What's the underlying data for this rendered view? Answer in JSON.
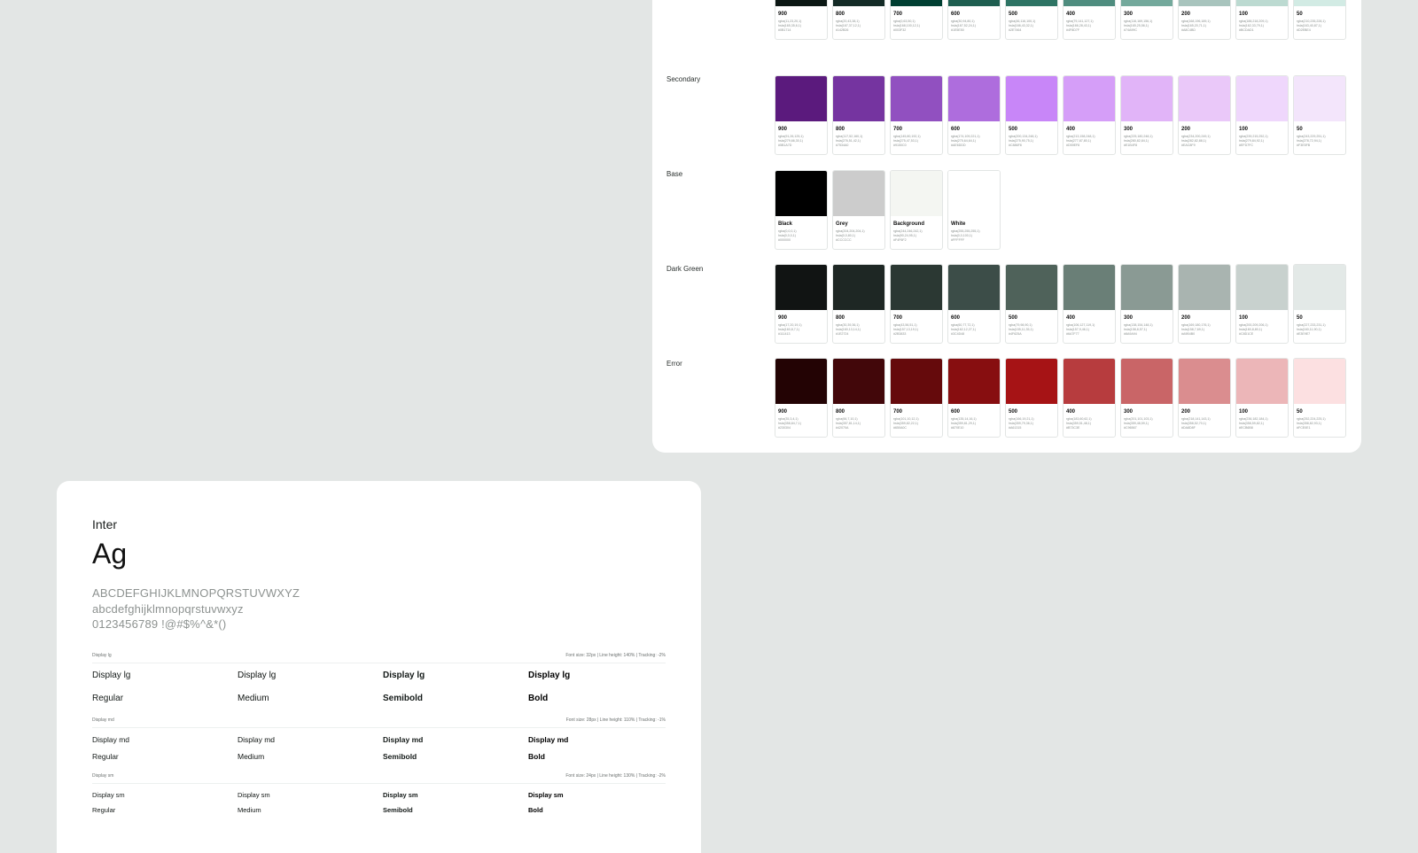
{
  "palette": {
    "rows": [
      {
        "label": "",
        "swatches": [
          {
            "name": "900",
            "color": "#0b1714",
            "detail": [
              "rgba(11,23,20,1)",
              "hsla(165,35,6,1)",
              "#0B1714"
            ]
          },
          {
            "name": "800",
            "color": "#142b26",
            "detail": [
              "rgba(20,43,38,1)",
              "hsla(167,37,12,1)",
              "#142B26"
            ]
          },
          {
            "name": "700",
            "color": "#003f32",
            "detail": [
              "rgba(0,63,50,1)",
              "hsla(168,100,12,1)",
              "#003F32"
            ]
          },
          {
            "name": "600",
            "color": "#1e5e50",
            "detail": [
              "rgba(30,94,80,1)",
              "hsla(167,52,24,1)",
              "#1E5E50"
            ]
          },
          {
            "name": "500",
            "color": "#2e7464",
            "detail": [
              "rgba(46,116,100,1)",
              "hsla(166,43,32,1)",
              "#2E7464"
            ]
          },
          {
            "name": "400",
            "color": "#4f8d7f",
            "detail": [
              "rgba(79,141,127,1)",
              "hsla(166,28,43,1)",
              "#4F8D7F"
            ]
          },
          {
            "name": "300",
            "color": "#74a99c",
            "detail": [
              "rgba(116,169,156,1)",
              "hsla(165,25,56,1)",
              "#74A99C"
            ]
          },
          {
            "name": "200",
            "color": "#a8c4bd",
            "detail": [
              "rgba(168,196,189,1)",
              "hsla(165,20,71,1)",
              "#A8C4BD"
            ]
          },
          {
            "name": "100",
            "color": "#bcdad1",
            "detail": [
              "rgba(188,218,209,1)",
              "hsla(162,33,79,1)",
              "#BCDAD1"
            ]
          },
          {
            "name": "50",
            "color": "#d2ebe4",
            "detail": [
              "rgba(210,235,228,1)",
              "hsla(163,40,87,1)",
              "#D2EBE4"
            ]
          }
        ]
      },
      {
        "label": "Secondary",
        "swatches": [
          {
            "name": "900",
            "color": "#5b1a7d",
            "detail": [
              "rgba(91,26,125,1)",
              "hsla(279,66,30,1)",
              "#5B1A7D"
            ]
          },
          {
            "name": "800",
            "color": "#7534a0",
            "detail": [
              "rgba(117,52,160,1)",
              "hsla(276,51,42,1)",
              "#7534A0"
            ]
          },
          {
            "name": "700",
            "color": "#9150c0",
            "detail": [
              "rgba(145,80,192,1)",
              "hsla(275,47,53,1)",
              "#9150C0"
            ]
          },
          {
            "name": "600",
            "color": "#ae6ddd",
            "detail": [
              "rgba(174,109,221,1)",
              "hsla(275,64,64,1)",
              "#AE6DDD"
            ]
          },
          {
            "name": "500",
            "color": "#c886f8",
            "detail": [
              "rgba(200,134,248,1)",
              "hsla(275,90,75,1)",
              "#C886F8"
            ]
          },
          {
            "name": "400",
            "color": "#d59ef8",
            "detail": [
              "rgba(213,158,248,1)",
              "hsla(277,87,80,1)",
              "#D59EF8"
            ]
          },
          {
            "name": "300",
            "color": "#e1b4f8",
            "detail": [
              "rgba(225,180,248,1)",
              "hsla(280,82,84,1)",
              "#E1B4F8"
            ]
          },
          {
            "name": "200",
            "color": "#eac8f9",
            "detail": [
              "rgba(234,200,249,1)",
              "hsla(282,82,88,1)",
              "#EAC8F9"
            ]
          },
          {
            "name": "100",
            "color": "#efd7fc",
            "detail": [
              "rgba(239,215,252,1)",
              "hsla(279,84,92,1)",
              "#EFD7FC"
            ]
          },
          {
            "name": "50",
            "color": "#f3e5fb",
            "detail": [
              "rgba(243,229,251,1)",
              "hsla(278,72,94,1)",
              "#F3E5FB"
            ]
          }
        ]
      },
      {
        "label": "Base",
        "swatches": [
          {
            "name": "Black",
            "color": "#000000",
            "detail": [
              "rgba(0,0,0,1)",
              "hsla(0,0,0,1)",
              "#000000"
            ]
          },
          {
            "name": "Grey",
            "color": "#cccccc",
            "detail": [
              "rgba(204,204,204,1)",
              "hsla(0,0,80,1)",
              "#CCCCCC"
            ]
          },
          {
            "name": "Background",
            "color": "#f4f6f2",
            "detail": [
              "rgba(244,246,242,1)",
              "hsla(90,24,95,1)",
              "#F4F6F2"
            ]
          },
          {
            "name": "White",
            "color": "#ffffff",
            "detail": [
              "rgba(255,255,255,1)",
              "hsla(0,0,100,1)",
              "#FFFFFF"
            ]
          }
        ]
      },
      {
        "label": "Dark Green",
        "swatches": [
          {
            "name": "900",
            "color": "#111413",
            "detail": [
              "rgba(17,20,19,1)",
              "hsla(160,8,7,1)",
              "#111413"
            ]
          },
          {
            "name": "800",
            "color": "#1e2724",
            "detail": [
              "rgba(30,39,36,1)",
              "hsla(160,13,14,1)",
              "#1E2724"
            ]
          },
          {
            "name": "700",
            "color": "#2b3833",
            "detail": [
              "rgba(43,56,51,1)",
              "hsla(157,13,19,1)",
              "#2B3833"
            ]
          },
          {
            "name": "600",
            "color": "#3c4d48",
            "detail": [
              "rgba(60,77,72,1)",
              "hsla(162,12,27,1)",
              "#3C4D48"
            ]
          },
          {
            "name": "500",
            "color": "#4f625a",
            "detail": [
              "rgba(79,98,90,1)",
              "hsla(155,11,35,1)",
              "#4F625A"
            ]
          },
          {
            "name": "400",
            "color": "#6a7f77",
            "detail": [
              "rgba(106,127,119,1)",
              "hsla(157,9,46,1)",
              "#6A7F77"
            ]
          },
          {
            "name": "300",
            "color": "#8a9a94",
            "detail": [
              "rgba(138,154,148,1)",
              "hsla(158,8,57,1)",
              "#8A9A94"
            ]
          },
          {
            "name": "200",
            "color": "#a9b4b0",
            "detail": [
              "rgba(169,180,176,1)",
              "hsla(158,7,69,1)",
              "#A9B4B0"
            ]
          },
          {
            "name": "100",
            "color": "#c8d1ce",
            "detail": [
              "rgba(200,209,206,1)",
              "hsla(160,8,80,1)",
              "#C8D1CE"
            ]
          },
          {
            "name": "50",
            "color": "#e3e9e7",
            "detail": [
              "rgba(227,233,231,1)",
              "hsla(160,11,90,1)",
              "#E3E9E7"
            ]
          }
        ]
      },
      {
        "label": "Error",
        "swatches": [
          {
            "name": "900",
            "color": "#230304",
            "detail": [
              "rgba(35,3,4,1)",
              "hsla(358,84,7,1)",
              "#230304"
            ]
          },
          {
            "name": "800",
            "color": "#42070a",
            "detail": [
              "rgba(66,7,10,1)",
              "hsla(357,81,14,1)",
              "#42070A"
            ]
          },
          {
            "name": "700",
            "color": "#650a0c",
            "detail": [
              "rgba(101,10,12,1)",
              "hsla(359,82,22,1)",
              "#650A0C"
            ]
          },
          {
            "name": "600",
            "color": "#870e10",
            "detail": [
              "rgba(135,14,16,1)",
              "hsla(359,81,29,1)",
              "#870E10"
            ]
          },
          {
            "name": "500",
            "color": "#a61315",
            "detail": [
              "rgba(166,19,21,1)",
              "hsla(359,79,36,1)",
              "#A61315"
            ]
          },
          {
            "name": "400",
            "color": "#b73c3e",
            "detail": [
              "rgba(183,60,62,1)",
              "hsla(359,51,48,1)",
              "#B73C3E"
            ]
          },
          {
            "name": "300",
            "color": "#c96567",
            "detail": [
              "rgba(201,101,103,1)",
              "hsla(359,48,59,1)",
              "#C96567"
            ]
          },
          {
            "name": "200",
            "color": "#da8d8f",
            "detail": [
              "rgba(218,141,143,1)",
              "hsla(358,52,70,1)",
              "#DA8D8F"
            ]
          },
          {
            "name": "100",
            "color": "#ecb6b8",
            "detail": [
              "rgba(236,182,184,1)",
              "hsla(358,59,82,1)",
              "#ECB6B8"
            ]
          },
          {
            "name": "50",
            "color": "#fce0e1",
            "detail": [
              "rgba(252,224,225,1)",
              "hsla(358,82,93,1)",
              "#FCE0E1"
            ]
          }
        ]
      }
    ]
  },
  "typography": {
    "font_name": "Inter",
    "sample": "Ag",
    "uppercase": "ABCDEFGHIJKLMNOPQRSTUVWXYZ",
    "lowercase": "abcdefghijklmnopqrstuvwxyz",
    "numerals": "0123456789 !@#$%^&*()",
    "sizes": [
      {
        "label": "Display lg",
        "meta": "Font size: 32px | Line height: 140% | Tracking: -2%",
        "sample": "Display lg",
        "weights": [
          "Regular",
          "Medium",
          "Semibold",
          "Bold"
        ]
      },
      {
        "label": "Display md",
        "meta": "Font size: 28px | Line height: 110% | Tracking: -1%",
        "sample": "Display md",
        "weights": [
          "Regular",
          "Medium",
          "Semibold",
          "Bold"
        ]
      },
      {
        "label": "Display sm",
        "meta": "Font size: 24px | Line height: 130% | Tracking: -2%",
        "sample": "Display sm",
        "weights": [
          "Regular",
          "Medium",
          "Semibold",
          "Bold"
        ]
      }
    ]
  }
}
